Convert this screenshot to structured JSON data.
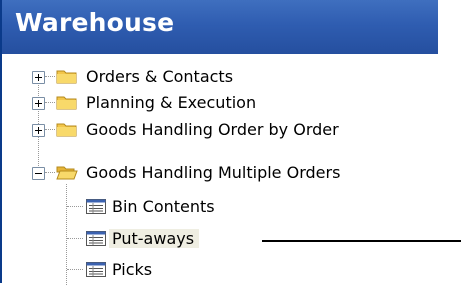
{
  "panel": {
    "title": "Warehouse"
  },
  "tree": {
    "items": [
      {
        "label": "Orders & Contacts",
        "expanded": false,
        "icon": "folder-icon"
      },
      {
        "label": "Planning & Execution",
        "expanded": false,
        "icon": "folder-icon"
      },
      {
        "label": "Goods Handling Order by Order",
        "expanded": false,
        "icon": "folder-icon"
      },
      {
        "label": "Goods Handling Multiple Orders",
        "expanded": true,
        "icon": "folder-open-icon",
        "children": [
          {
            "label": "Bin Contents",
            "icon": "list-form-icon"
          },
          {
            "label": "Put-aways",
            "icon": "list-form-icon",
            "selected": true
          },
          {
            "label": "Picks",
            "icon": "list-form-icon"
          }
        ]
      }
    ]
  },
  "colors": {
    "header": "#2f5db1",
    "folder": "#f3c64a",
    "selection": "#efeee2"
  }
}
